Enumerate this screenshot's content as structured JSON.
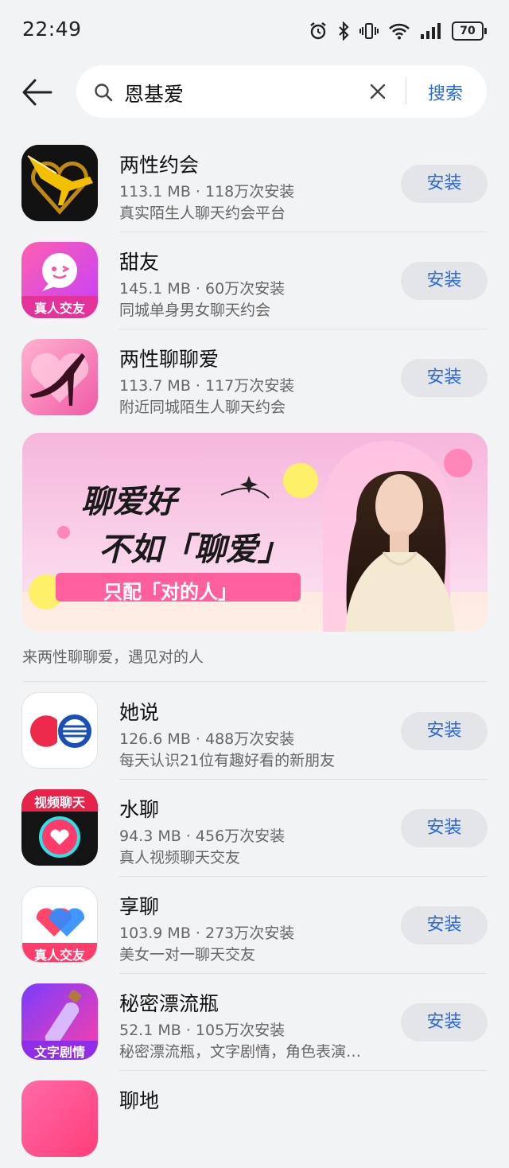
{
  "status_bar": {
    "time": "22:49",
    "battery": "70"
  },
  "search": {
    "query": "恩基爱",
    "submit_label": "搜索"
  },
  "apps": [
    {
      "name": "两性约会",
      "meta": "113.1 MB · 118万次安装",
      "desc": "真实陌生人聊天约会平台",
      "install_label": "安装"
    },
    {
      "name": "甜友",
      "meta": "145.1 MB · 60万次安装",
      "desc": "同城单身男女聊天约会",
      "install_label": "安装",
      "badge": "真人交友"
    },
    {
      "name": "两性聊聊爱",
      "meta": "113.7 MB · 117万次安装",
      "desc": "附近同城陌生人聊天约会",
      "install_label": "安装"
    }
  ],
  "banner": {
    "headline1": "聊爱好",
    "headline2": "不如「聊爱」",
    "tagline": "只配「对的人」",
    "caption": "来两性聊聊爱，遇见对的人"
  },
  "apps2": [
    {
      "name": "她说",
      "meta": "126.6 MB · 488万次安装",
      "desc": "每天认识21位有趣好看的新朋友",
      "install_label": "安装"
    },
    {
      "name": "水聊",
      "meta": "94.3 MB · 456万次安装",
      "desc": "真人视频聊天交友",
      "install_label": "安装",
      "badge": "视频聊天"
    },
    {
      "name": "享聊",
      "meta": "103.9 MB · 273万次安装",
      "desc": "美女一对一聊天交友",
      "install_label": "安装",
      "badge": "真人交友"
    },
    {
      "name": "秘密漂流瓶",
      "meta": "52.1 MB · 105万次安装",
      "desc": "秘密漂流瓶，文字剧情，角色表演…",
      "install_label": "安装",
      "badge": "文字剧情"
    },
    {
      "name": "聊地"
    }
  ],
  "colors": {
    "accent": "#2a6ad6",
    "install_bg": "#e3e5e8",
    "page_bg": "#f1f3f5"
  }
}
